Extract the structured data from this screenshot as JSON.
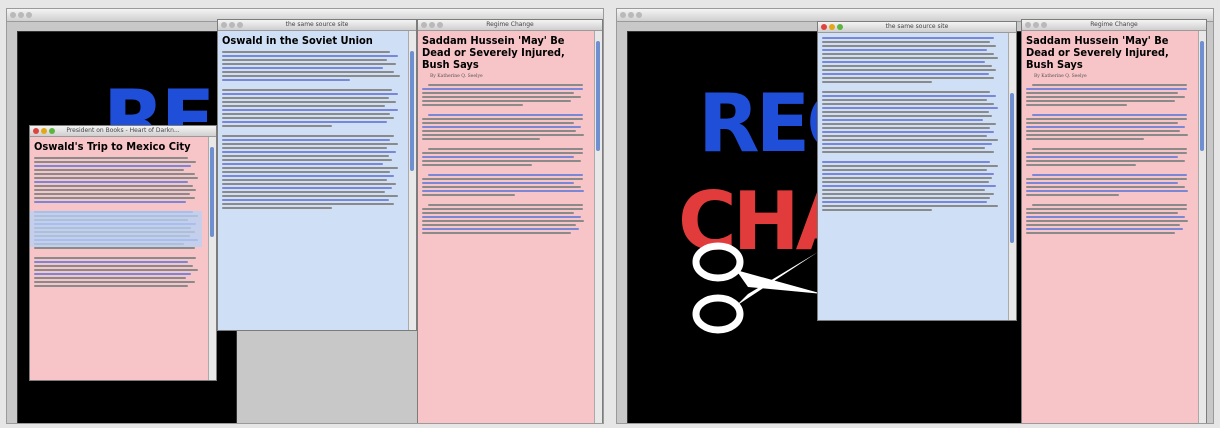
{
  "left_panel": {
    "regime_window": {
      "title": "Regime Change",
      "headline": "Saddam Hussein 'May' Be Dead or Severely Injured, Bush Says",
      "byline": "By Katherine Q. Seelye"
    },
    "soviet_window": {
      "title": "the same source site",
      "headline": "Oswald in the Soviet Union"
    },
    "mexico_window": {
      "title": "President on Books - Heart of Darkn...",
      "headline": "Oswald's Trip to Mexico City"
    },
    "background_text": "RE"
  },
  "right_panel": {
    "regime_window": {
      "title": "Regime Change",
      "headline": "Saddam Hussein 'May' Be Dead or Severely Injured, Bush Says",
      "byline": "By Katherine Q. Seelye"
    },
    "soviet_window": {
      "title": "the same source site"
    },
    "logo": {
      "line1": "REG",
      "line2": "CHA"
    }
  },
  "colors": {
    "pink": "#f7c4c7",
    "blue": "#cfe0f6",
    "red": "#e23b3b",
    "logo_blue": "#1f4fd8"
  }
}
